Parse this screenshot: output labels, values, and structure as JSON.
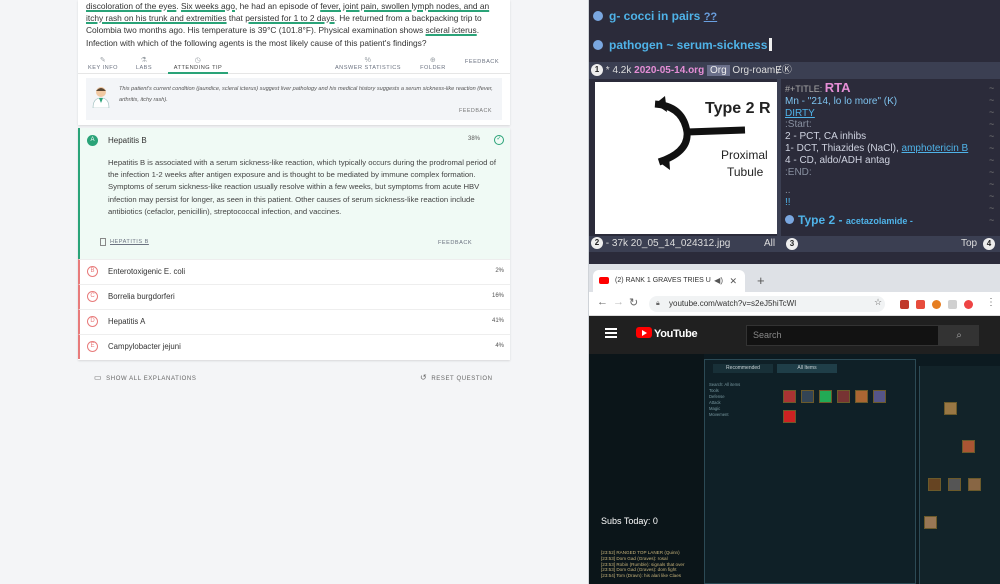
{
  "question": {
    "stem_segments": [
      {
        "text": "discoloration of the eyes",
        "u": true
      },
      {
        "text": ". ",
        "u": false
      },
      {
        "text": "Six weeks ago",
        "u": true
      },
      {
        "text": ", he had an episode of ",
        "u": false
      },
      {
        "text": "fever, joint pain, swollen lymph nodes, and an itchy rash on his trunk and extremities",
        "u": true
      },
      {
        "text": " that ",
        "u": false
      },
      {
        "text": "persisted for 1 to 2 days",
        "u": true
      },
      {
        "text": ". He returned from a backpacking trip to Colombia two months ago. His temperature is 39°C (101.8°F). Physical examination shows ",
        "u": false
      },
      {
        "text": "scleral icterus",
        "u": true
      },
      {
        "text": ". Infection with which of the following agents is the most likely cause of this patient's findings?",
        "u": false
      }
    ],
    "toolbar": {
      "key_info": "KEY INFO",
      "labs": "LABS",
      "attending_tip": "ATTENDING TIP",
      "answer_statistics": "ANSWER STATISTICS",
      "folder": "FOLDER",
      "feedback": "FEEDBACK"
    },
    "tip": {
      "text": "This patient's current condition (jaundice, scleral icterus) suggest liver pathology and his medical history suggests a serum sickness-like reaction (fever, arthritis, itchy rash).",
      "feedback": "FEEDBACK"
    },
    "correct_answer": {
      "letter": "A",
      "label": "Hepatitis B",
      "pct": "38%",
      "explanation": "Hepatitis B is associated with a serum sickness-like reaction, which typically occurs during the prodromal period of the infection 1-2 weeks after antigen exposure and is thought to be mediated by immune complex formation. Symptoms of serum sickness-like reaction usually resolve within a few weeks, but symptoms from acute HBV infection may persist for longer, as seen in this patient. Other causes of serum sickness-like reaction include antibiotics (cefaclor, penicillin), streptococcal infection, and vaccines.",
      "link": "HEPATITIS B",
      "feedback": "FEEDBACK"
    },
    "other_answers": [
      {
        "letter": "B",
        "label": "Enterotoxigenic E. coli",
        "pct": "2%"
      },
      {
        "letter": "C",
        "label": "Borrelia burgdorferi",
        "pct": "16%"
      },
      {
        "letter": "D",
        "label": "Hepatitis A",
        "pct": "41%"
      },
      {
        "letter": "E",
        "label": "Campylobacter jejuni",
        "pct": "4%"
      }
    ],
    "show_all": "SHOW ALL EXPLANATIONS",
    "reset": "RESET QUESTION"
  },
  "emacs": {
    "line1": "g- cocci in pairs",
    "line1_q": "??",
    "line2": "pathogen ~ serum-sickness",
    "modeline": {
      "num": "1",
      "size": "* 4.2k",
      "file": "2020-05-14.org",
      "mode": "Org",
      "extra": "Org-roamɆⓀ"
    },
    "image_labels": {
      "type": "Type 2 R",
      "proximal": "Proximal",
      "tubule": "Tubule"
    },
    "org": {
      "title_prefix": "#+TITLE:",
      "title": "RTA",
      "mn": "Mn - \"214, lo lo more\" (K)",
      "dirty": "DIRTY",
      "start": ":Start:",
      "l1": "2 - PCT, CA inhibs",
      "l2_a": "1- DCT, Thiazides (NaCl), ",
      "l2_link": "amphotericin B",
      "l3": "4 - CD, aldo/ADH antag",
      "end": ":END:",
      "dots": "..",
      "bang": "!!",
      "h2": "Type 2 -",
      "h2_sub": "acetazolamide -"
    },
    "modeline2": {
      "num": "2",
      "text": "- 37k 20_05_14_024312.jpg",
      "all": "All",
      "num3": "3",
      "top": "Top",
      "num4": "4"
    }
  },
  "browser": {
    "tab_title": "(2) RANK 1 GRAVES TRIES U",
    "url": "youtube.com/watch?v=s2eJ5hiTcWI",
    "search_placeholder": "Search",
    "logo": "YouTube",
    "subs": "Subs Today: 0",
    "chat": [
      "[23:52] RANGED TOP LANER (Quinn)",
      "[23:53] Dom Gad (Graves): rosal",
      "[23:53] Robin (Rumble): signals that over",
      "[23:53] Dom Gad (Graves): dom fight",
      "[23:54] Tom (Dravn): his alari like Claes"
    ],
    "game_tabs": [
      "Recommended",
      "All Items"
    ],
    "game_menu": [
      "Search: All items",
      "Tools",
      "Defense",
      "Attack",
      "Magic",
      "Movement"
    ]
  },
  "colors": {
    "accent_green": "#2aa378",
    "wrong_red": "#e87b7b",
    "org_blue": "#4fb3e8",
    "org_pink": "#e58ed6"
  }
}
